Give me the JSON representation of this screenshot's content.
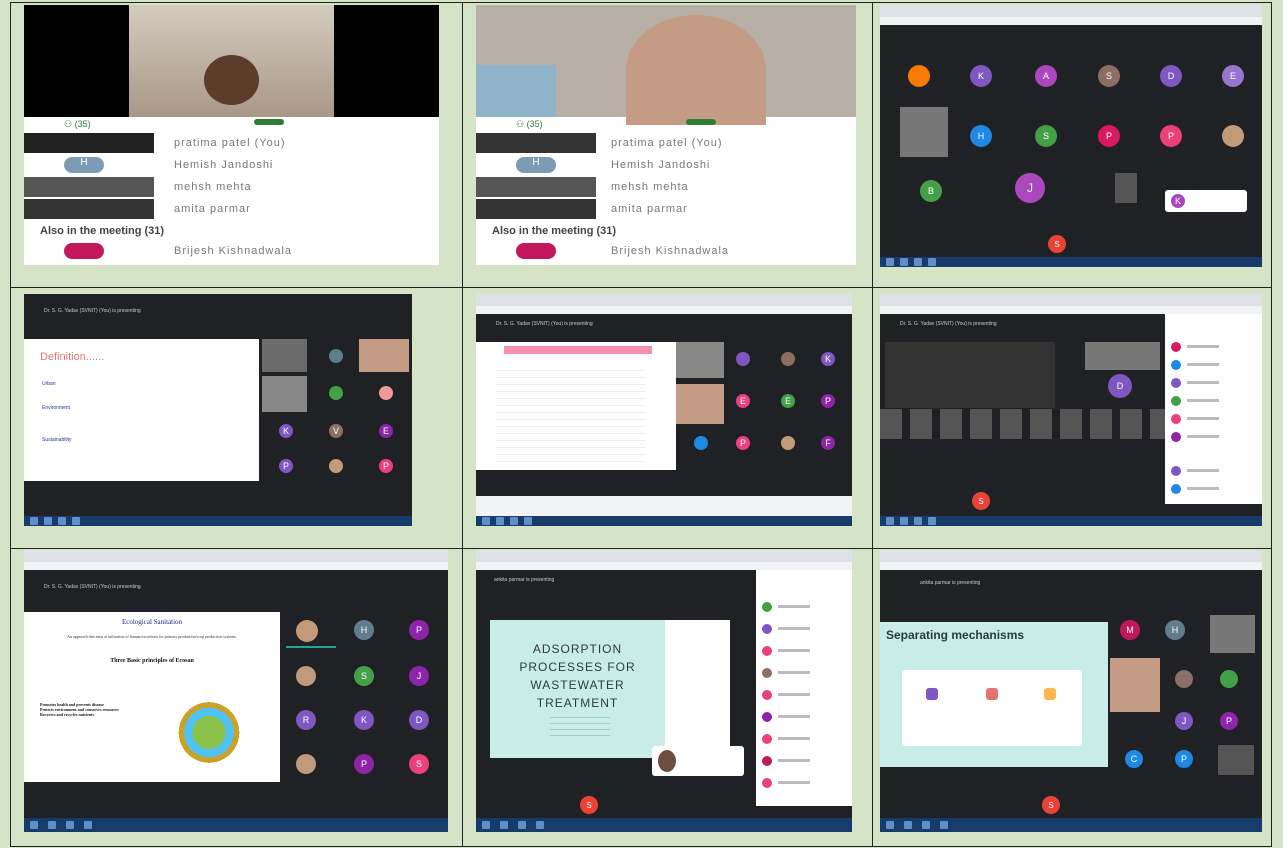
{
  "cells": {
    "c1": {
      "participants_label": "(35)",
      "rows": [
        "pratima patel (You)",
        "Hemish Jandoshi",
        "mehsh mehta",
        "amita parmar"
      ],
      "also_in_meeting": "Also in the meeting (31)",
      "last_row": "Brijesh Kishnadwala"
    },
    "c2": {
      "participants_label": "(35)",
      "rows": [
        "pratima patel (You)",
        "Hemish Jandoshi",
        "mehsh mehta",
        "amita parmar"
      ],
      "also_in_meeting": "Also in the meeting (31)",
      "last_row": "Brijesh Kishnadwala"
    },
    "c3": {
      "tile_letters": [
        "K",
        "A",
        "S",
        "D",
        "E",
        "H",
        "S",
        "P",
        "P",
        "B",
        "J",
        "K"
      ],
      "end_call": "S"
    },
    "c4": {
      "banner": "Dr. S. G. Yadav (SVNIT) (You) is presenting",
      "slide_title": "Definition......",
      "slide_items": [
        "Urban",
        "Environment",
        "Sustainability"
      ],
      "tile_letters": [
        "K",
        "V",
        "E",
        "P",
        "L",
        "P",
        "P"
      ]
    },
    "c5": {
      "banner": "Dr. S. G. Yadav (SVNIT) (You) is presenting",
      "tile_letters": [
        "K",
        "E",
        "E",
        "P",
        "F",
        "P"
      ]
    },
    "c6": {
      "banner": "Dr. S. G. Yadav (SVNIT) (You) is presenting",
      "tile_letters": [
        "D"
      ],
      "end_call": "S"
    },
    "c7": {
      "banner": "Dr. S. G. Yadav (SVNIT) (You) is presenting",
      "slide_title": "Ecological Sanitation",
      "slide_sub": "An approach that aims at utilization of human excretions for primary production/crop production systems.",
      "slide_heading": "Three Basic principles of Ecosan",
      "slide_points": [
        "Promotes health and prevents disease",
        "Protects environment and conserves resources",
        "Recovers and recycles nutrients"
      ],
      "tile_letters": [
        "H",
        "P",
        "S",
        "J",
        "R",
        "K",
        "D",
        "B",
        "P",
        "S"
      ]
    },
    "c8": {
      "banner": "ankita parmar is presenting",
      "slide_title": "ADSORPTION PROCESSES FOR WASTEWATER TREATMENT",
      "end_call": "S"
    },
    "c9": {
      "banner": "ankita parmar is presenting",
      "slide_title": "Separating mechanisms",
      "tile_letters": [
        "M",
        "H",
        "J",
        "P",
        "C",
        "P"
      ],
      "end_call": "S"
    }
  }
}
